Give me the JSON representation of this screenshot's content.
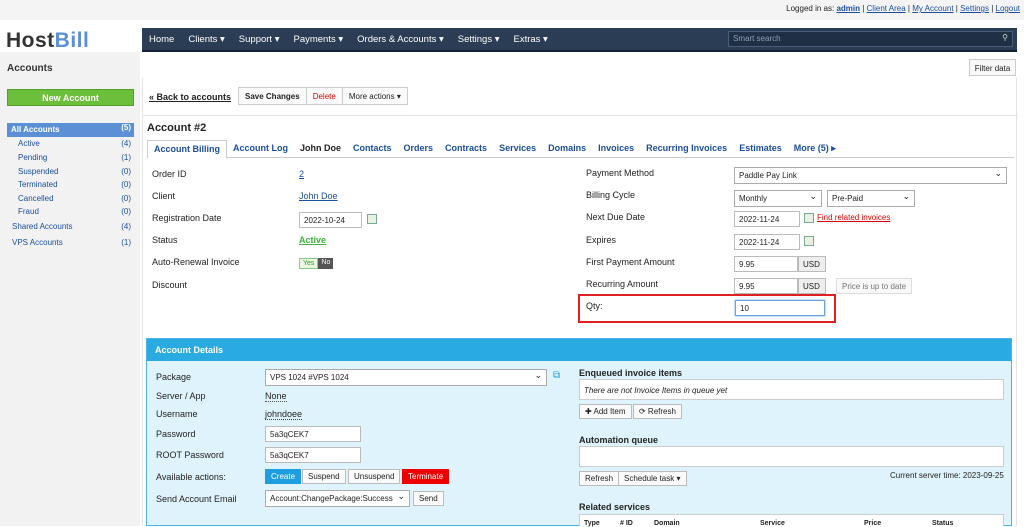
{
  "topbar": {
    "logged_in_as": "Logged in as:",
    "user": "admin",
    "links": [
      "Client Area",
      "My Account",
      "Settings",
      "Logout"
    ]
  },
  "logo": {
    "host": "Host",
    "bill": "Bill"
  },
  "nav": {
    "items": [
      "Home",
      "Clients ▾",
      "Support ▾",
      "Payments ▾",
      "Orders & Accounts ▾",
      "Settings ▾",
      "Extras ▾"
    ],
    "search_placeholder": "Smart search"
  },
  "sidebar": {
    "title": "Accounts",
    "new_button": "New Account",
    "items": [
      {
        "label": "All Accounts",
        "count": "(5)"
      },
      {
        "label": "Active",
        "count": "(4)"
      },
      {
        "label": "Pending",
        "count": "(1)"
      },
      {
        "label": "Suspended",
        "count": "(0)"
      },
      {
        "label": "Terminated",
        "count": "(0)"
      },
      {
        "label": "Cancelled",
        "count": "(0)"
      },
      {
        "label": "Fraud",
        "count": "(0)"
      },
      {
        "label": "Shared Accounts",
        "count": "(4)"
      },
      {
        "label": "VPS Accounts",
        "count": "(1)"
      }
    ]
  },
  "filter_button": "Filter data",
  "actionbar": {
    "back": "« Back to accounts",
    "save": "Save Changes",
    "delete": "Delete",
    "more": "More actions ▾"
  },
  "account": {
    "title": "Account #2",
    "tabs": [
      "Account Billing",
      "Account Log",
      "John Doe",
      "Contacts",
      "Orders",
      "Contracts",
      "Services",
      "Domains",
      "Invoices",
      "Recurring Invoices",
      "Estimates",
      "More (5) ▸"
    ],
    "left": {
      "order_id_label": "Order ID",
      "order_id": "2",
      "client_label": "Client",
      "client": "John Doe",
      "regdate_label": "Registration Date",
      "regdate": "2022-10-24",
      "status_label": "Status",
      "status": "Active",
      "autorenew_label": "Auto-Renewal Invoice",
      "yes": "Yes",
      "no": "No",
      "discount_label": "Discount"
    },
    "right": {
      "payment_label": "Payment Method",
      "payment": "Paddle Pay Link",
      "cycle_label": "Billing Cycle",
      "cycle": "Monthly",
      "cycle_type": "Pre-Paid",
      "nextdue_label": "Next Due Date",
      "nextdue": "2022-11-24",
      "find_invoices": "Find related invoices",
      "expires_label": "Expires",
      "expires": "2022-11-24",
      "first_label": "First Payment Amount",
      "first": "9.95",
      "currency": "USD",
      "recurring_label": "Recurring Amount",
      "recurring": "9.95",
      "price_status": "Price is up to date",
      "qty_label": "Qty:",
      "qty": "10"
    }
  },
  "details": {
    "header": "Account Details",
    "package_label": "Package",
    "package": "VPS 1024 #VPS 1024",
    "server_label": "Server / App",
    "server": "None",
    "username_label": "Username",
    "username": "johndoee",
    "password_label": "Password",
    "password": "5a3qCEK7",
    "root_label": "ROOT Password",
    "root": "5a3qCEK7",
    "actions_label": "Available actions:",
    "actions": [
      "Create",
      "Suspend",
      "Unsuspend",
      "Terminate"
    ],
    "email_label": "Send Account Email",
    "email": "Account:ChangePackage:Success",
    "send": "Send",
    "enqueued_title": "Enqueued invoice items",
    "enqueued_empty": "There are not Invoice Items in queue yet",
    "add_item": "✚ Add Item",
    "refresh": "⟳ Refresh",
    "automation_title": "Automation queue",
    "refresh2": "Refresh",
    "schedule": "Schedule task ▾",
    "server_time": "Current server time: 2023-09-25",
    "related_title": "Related services",
    "related_cols": [
      "Type",
      "# ID",
      "Domain",
      "Service",
      "Price",
      "Status"
    ]
  }
}
